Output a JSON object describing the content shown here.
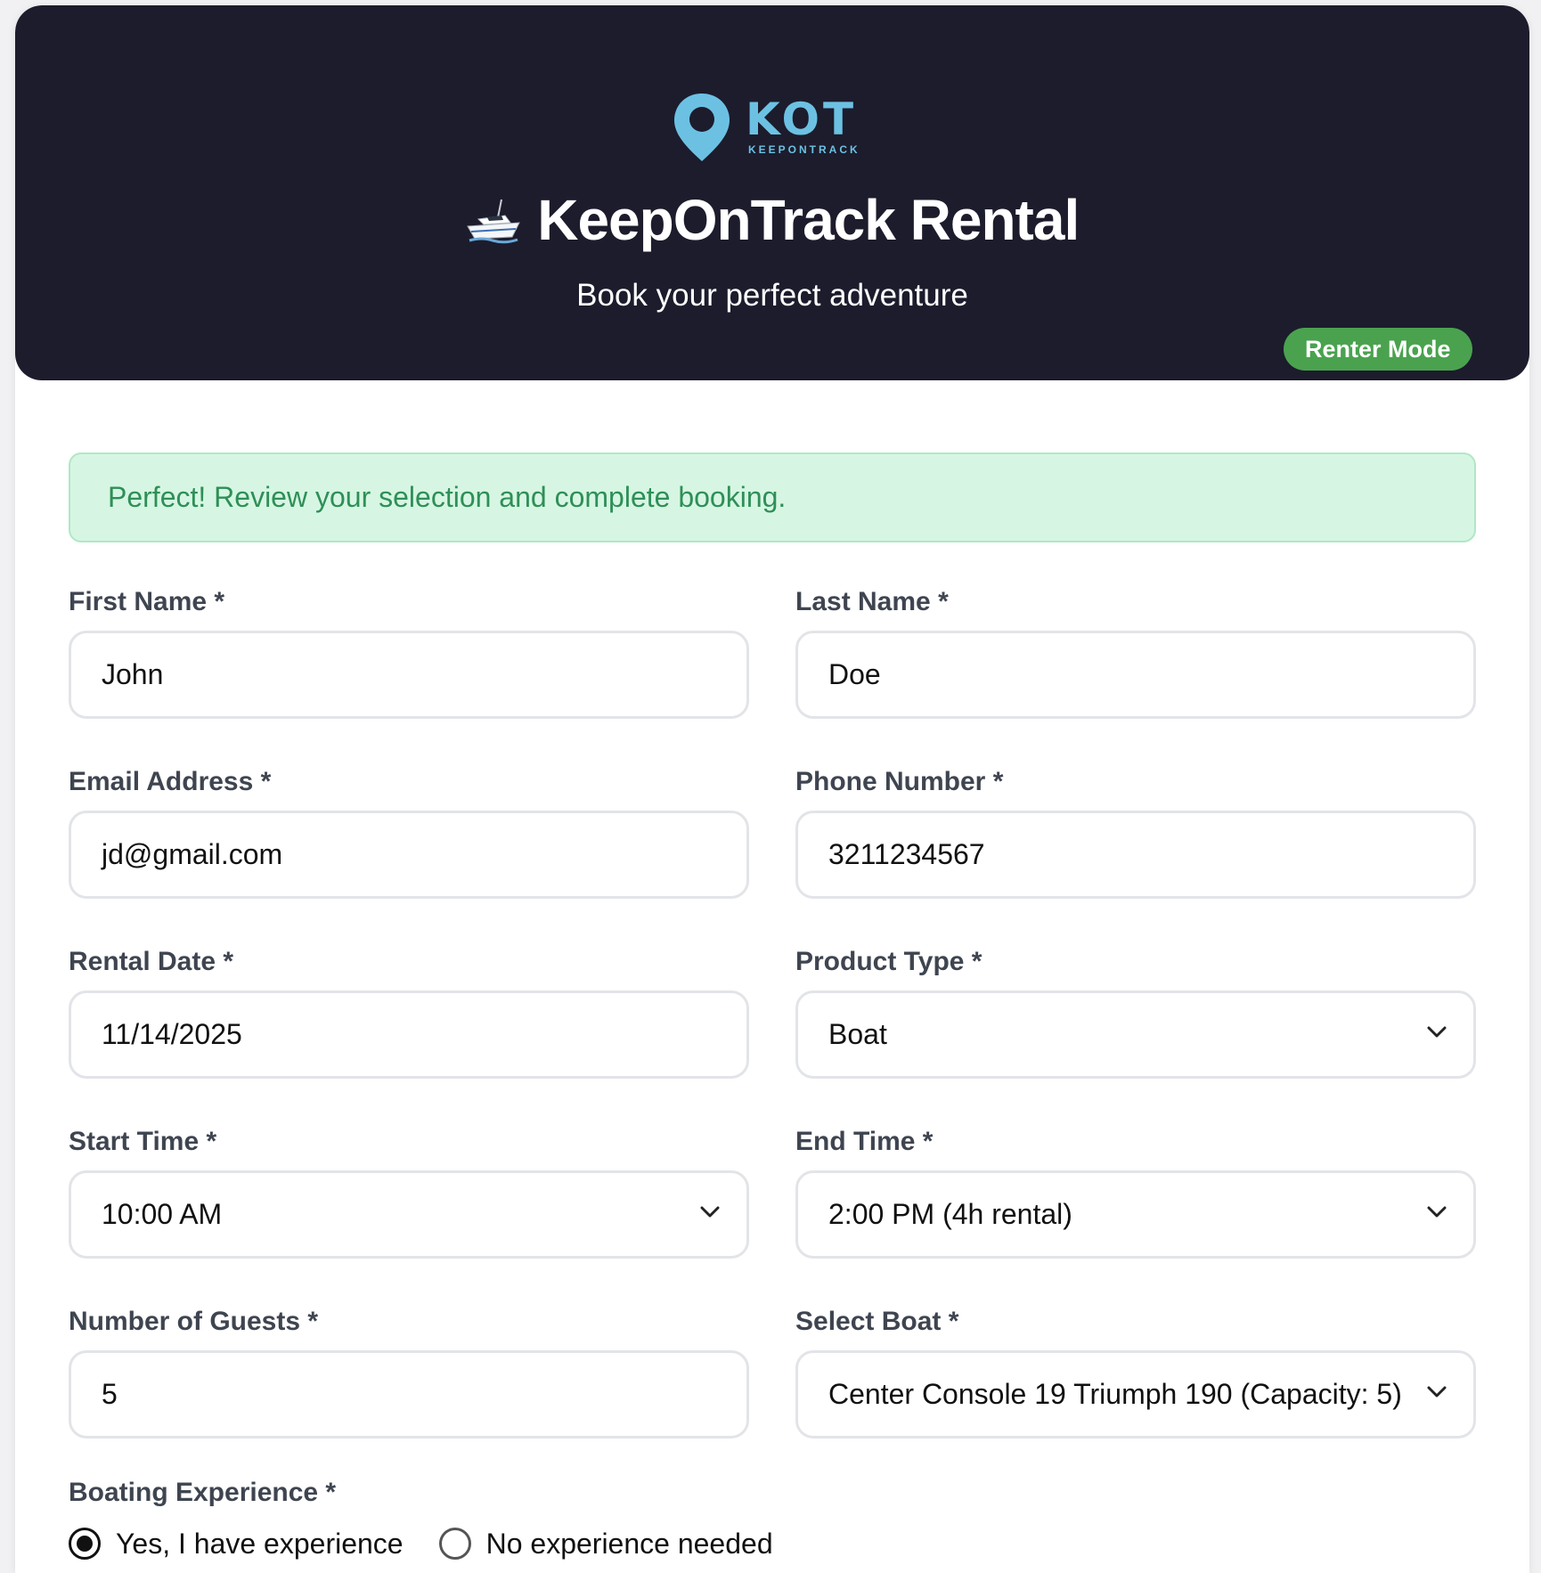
{
  "header": {
    "logo_text": "KOT",
    "logo_sub": "KEEPONTRACK",
    "title": "KeepOnTrack Rental",
    "subtitle": "Book your perfect adventure",
    "mode_badge": "Renter Mode",
    "icons": [
      "map-pin-icon",
      "boat-icon"
    ],
    "colors": {
      "header_bg": "#1c1c2c",
      "logo": "#6cc1e3",
      "badge": "#4aa24f"
    }
  },
  "alert": {
    "text": "Perfect! Review your selection and complete booking.",
    "colors": {
      "bg": "#d6f6e3",
      "text": "#2f8f57"
    }
  },
  "form": {
    "first_name": {
      "label": "First Name *",
      "value": "John"
    },
    "last_name": {
      "label": "Last Name *",
      "value": "Doe"
    },
    "email": {
      "label": "Email Address *",
      "value": "jd@gmail.com"
    },
    "phone": {
      "label": "Phone Number *",
      "value": "3211234567"
    },
    "rental_date": {
      "label": "Rental Date *",
      "value": "11/14/2025"
    },
    "product_type": {
      "label": "Product Type *",
      "value": "Boat"
    },
    "start_time": {
      "label": "Start Time *",
      "value": "10:00 AM"
    },
    "end_time": {
      "label": "End Time *",
      "value": "2:00 PM (4h rental)"
    },
    "guests": {
      "label": "Number of Guests *",
      "value": "5"
    },
    "boat": {
      "label": "Select Boat *",
      "value": "Center Console 19 Triumph 190 (Capacity: 5)"
    },
    "experience": {
      "label": "Boating Experience *",
      "options": [
        {
          "label": "Yes, I have experience",
          "selected": true
        },
        {
          "label": "No experience needed",
          "selected": false
        }
      ]
    }
  }
}
